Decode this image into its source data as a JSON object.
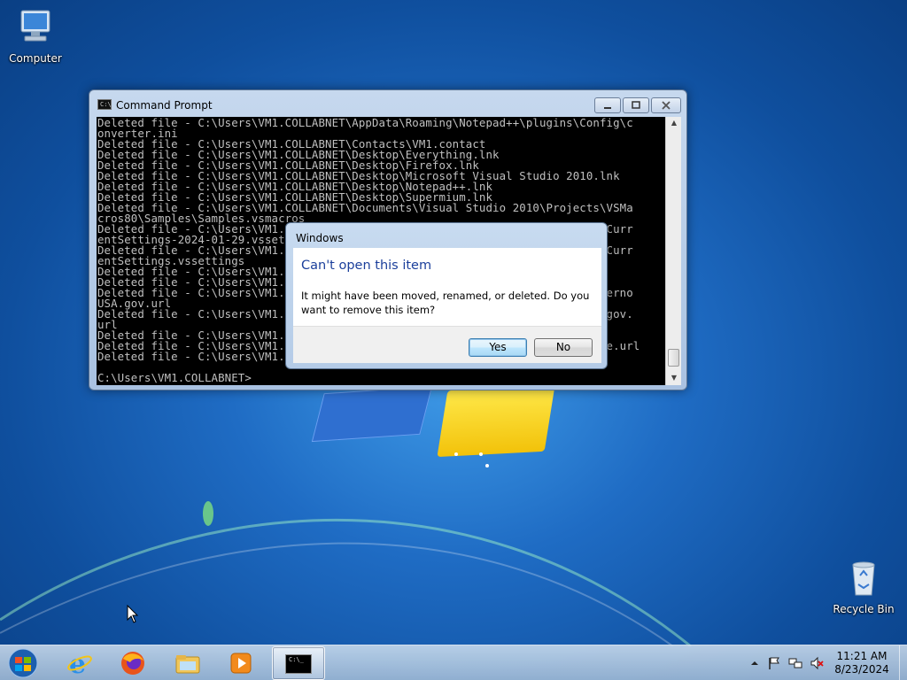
{
  "desktop": {
    "computer_label": "Computer",
    "recycle_label": "Recycle Bin"
  },
  "cmd": {
    "title": "Command Prompt",
    "lines": [
      "Deleted file - C:\\Users\\VM1.COLLABNET\\AppData\\Roaming\\Notepad++\\plugins\\Config\\c",
      "onverter.ini",
      "Deleted file - C:\\Users\\VM1.COLLABNET\\Contacts\\VM1.contact",
      "Deleted file - C:\\Users\\VM1.COLLABNET\\Desktop\\Everything.lnk",
      "Deleted file - C:\\Users\\VM1.COLLABNET\\Desktop\\Firefox.lnk",
      "Deleted file - C:\\Users\\VM1.COLLABNET\\Desktop\\Microsoft Visual Studio 2010.lnk",
      "Deleted file - C:\\Users\\VM1.COLLABNET\\Desktop\\Notepad++.lnk",
      "Deleted file - C:\\Users\\VM1.COLLABNET\\Desktop\\Supermium.lnk",
      "Deleted file - C:\\Users\\VM1.COLLABNET\\Documents\\Visual Studio 2010\\Projects\\VSMa",
      "cros80\\Samples\\Samples.vsmacros",
      "Deleted file - C:\\Users\\VM1.COLLABNET\\Documents\\Visual Studio 2010\\Settings\\Curr",
      "entSettings-2024-01-29.vssettings",
      "Deleted file - C:\\Users\\VM1.COLLABNET\\Documents\\Visual Studio 2010\\Settings\\Curr",
      "entSettings.vssettings",
      "Deleted file - C:\\Users\\VM1.COLLABNET\\Favorites\\Links\\Suggested Sites.url",
      "Deleted file - C:\\Users\\VM1.COLLABNET\\Favorites\\Links\\Web Slice Gallery.url",
      "Deleted file - C:\\Users\\VM1.COLLABNET\\Favorites\\Links for United States\\Gobierno",
      "USA.gov.url",
      "Deleted file - C:\\Users\\VM1.COLLABNET\\Favorites\\Links for United States\\USA.gov.",
      "url",
      "Deleted file - C:\\Users\\VM1.COLLABNET\\Favorites\\MSN Websites\\MSN.url",
      "Deleted file - C:\\Users\\VM1.COLLABNET\\Favorites\\Windows Live\\Get Windows Live.url",
      "Deleted file - C:\\Users\\VM1.COLLABNET\\Links\\Desktop.lnk",
      "",
      "C:\\Users\\VM1.COLLABNET>"
    ]
  },
  "dialog": {
    "title": "Windows",
    "heading": "Can't open this item",
    "message": "It might have been moved, renamed, or deleted. Do you want to remove this item?",
    "yes_label": "Yes",
    "no_label": "No"
  },
  "taskbar": {
    "pinned": [
      "start-orb",
      "internet-explorer",
      "firefox",
      "windows-explorer",
      "media-player"
    ],
    "active": "command-prompt",
    "console_glyph": "C:\\_",
    "time": "11:21 AM",
    "date": "8/23/2024"
  }
}
